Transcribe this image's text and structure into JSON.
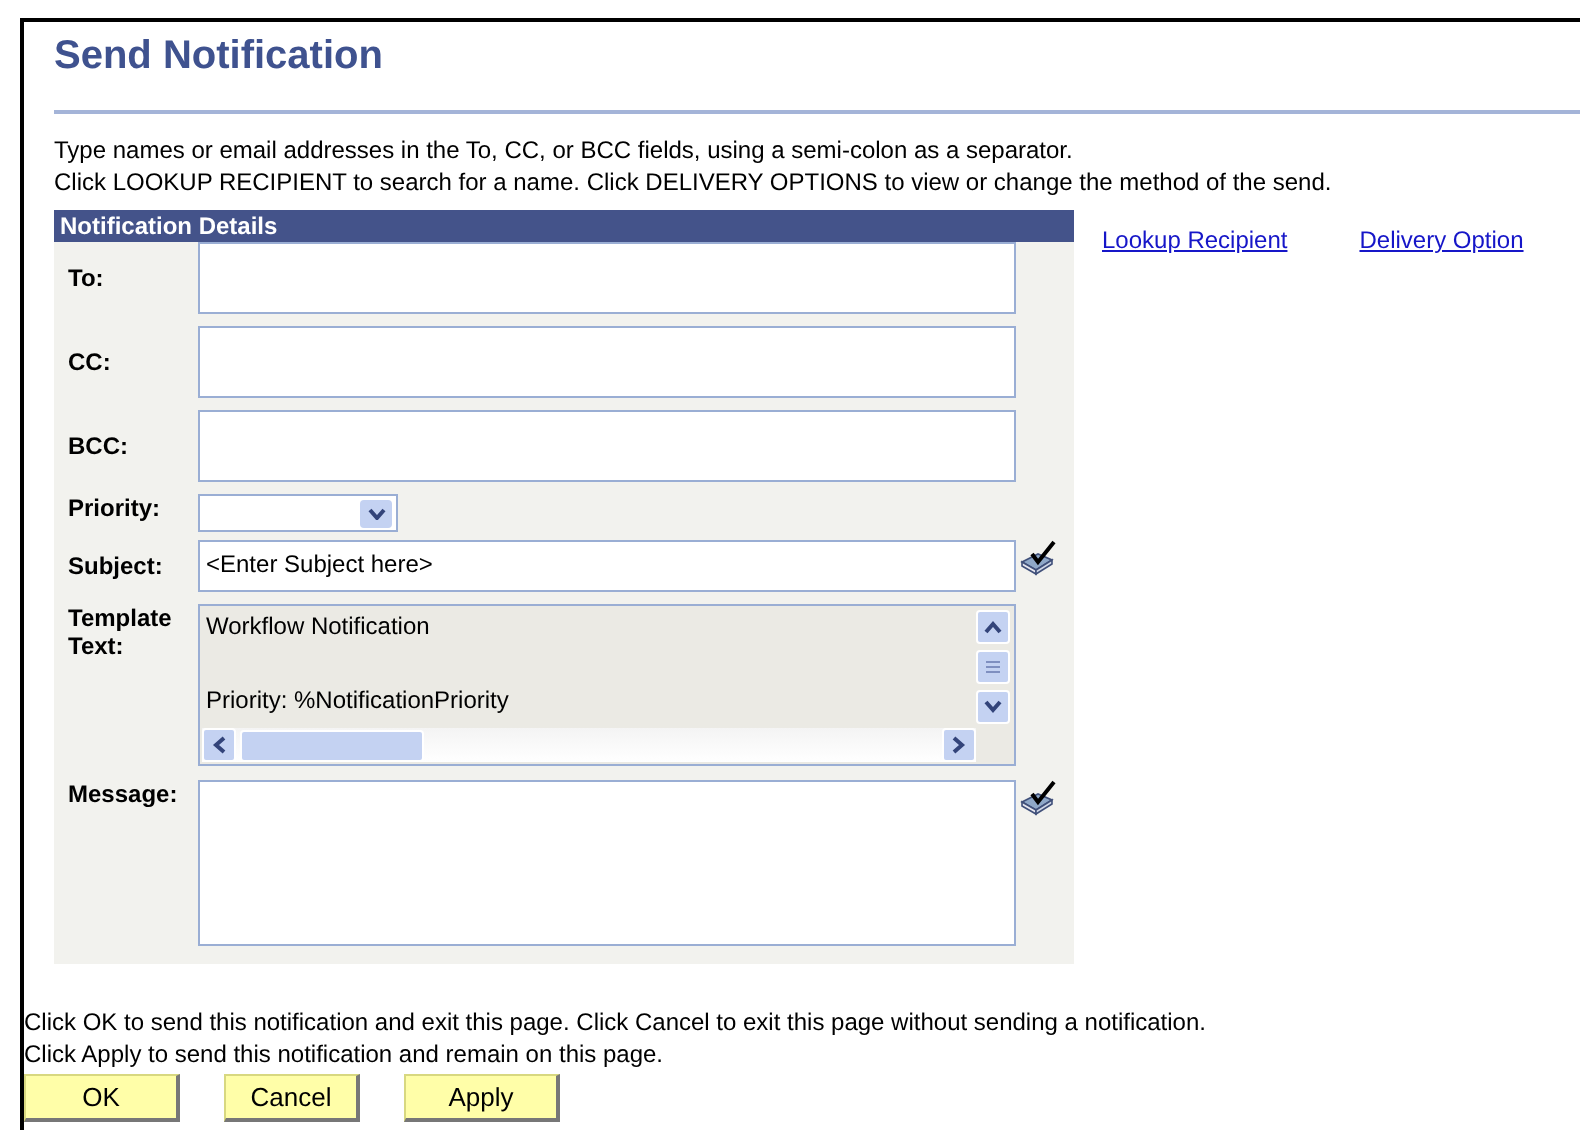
{
  "title": "Send Notification",
  "instructions": [
    "Type names or email addresses in the To, CC, or BCC fields, using a semi-colon as a separator.",
    "Click LOOKUP RECIPIENT to search for a name.  Click DELIVERY OPTIONS to view or change the method of the send."
  ],
  "panel": {
    "header": "Notification Details",
    "fields": [
      {
        "kind": "text",
        "label": "To:"
      },
      {
        "kind": "text",
        "label": "CC:"
      },
      {
        "kind": "text",
        "label": "BCC:"
      },
      {
        "kind": "select",
        "label": "Priority:"
      },
      {
        "kind": "line",
        "label": "Subject:",
        "value": "<Enter Subject here>",
        "spellcheck": true
      },
      {
        "kind": "template",
        "label": "Template Text:",
        "lines": [
          "Workflow Notification",
          "Priority:  %NotificationPriority"
        ]
      },
      {
        "kind": "textarea",
        "label": "Message:",
        "spellcheck": true
      }
    ]
  },
  "links": [
    "Lookup Recipient",
    "Delivery Option"
  ],
  "footer": [
    "Click OK to send this notification and exit this page.  Click Cancel to exit this page without sending a notification.",
    "Click Apply to send this notification and remain on this page."
  ],
  "buttons": [
    "OK",
    "Cancel",
    "Apply"
  ]
}
